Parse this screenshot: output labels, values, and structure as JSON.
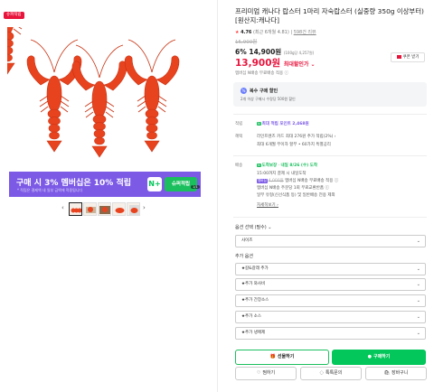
{
  "gallery": {
    "badge": "슈퍼적립",
    "promo_main": "구매 시 3% 멤버십은 10% 적립",
    "promo_sub": "* 적립은 결제액 내 일부 금액에 적용됩니다",
    "promo_n": "N+",
    "promo_super": "슈퍼적립",
    "page_indicator": "1/1",
    "prev": "‹",
    "next": "›",
    "lobster_color": "#e8431f"
  },
  "product": {
    "title": "프리미엄 캐나다 랍스터 1마리 자숙랍스터 (실중량 350g 이상부터) [원산지:캐나다]",
    "star": "★",
    "score": "4.76",
    "rating_note": "(최근 6개월 4.81)",
    "reviews": "598건 리뷰",
    "original_price": "15,900원",
    "discount_line": "6% 14,900원",
    "unit_price": "(100g당 4,257원)",
    "max_price": "13,900원",
    "max_label": "최대할인가 ⌄",
    "coupon_label": "쿠폰 받기",
    "membership_line_strike": "4,000원",
    "membership_line": "멤버십 N배송 무료배송 적용 ⓘ"
  },
  "multi_discount": {
    "icon": "%",
    "title": "복수 구매 할인",
    "desc": "2개 이상 구매시 수량당 500원 할인"
  },
  "benefits": {
    "point_label": "적립",
    "point_tag": "N",
    "point_text": "최대 적립 포인트 2,468원",
    "benefit_label": "혜택",
    "benefit_line1": "라인프렌즈 카드 최대 276원 추가 적립(2%) ›",
    "benefit_line2": "최대 6개월 무이자 할부 • 60가지 특별공리"
  },
  "delivery": {
    "label": "배송",
    "tag": "N",
    "tag_text": "도착보장",
    "arrive": "내일 8/26 (수) 도착",
    "line2": "15:00까지 결제 시 내일도착",
    "mem_tag": "멤버십",
    "line3_strike": "4,000원",
    "line3": "멤버십 N배송 무료배송 적용 ⓘ",
    "line4": "멤버십 N배송 주문당 1회 무료교환반품 ⓘ",
    "line5": "일부 유형(신선식품 등) 및 일반배송 전용 제외",
    "more": "자세히보기 ›"
  },
  "options": {
    "title": "옵션 선택 (필수) ⌄",
    "size_select": "사이즈",
    "extra_title": "추가 옵션",
    "extras": [
      "★갈&갈래 추가",
      "★추가 와사비",
      "★추가 간장소스",
      "★추가 소스",
      "★추가 냉매제"
    ],
    "chevron": "⌄"
  },
  "actions": {
    "cart": "선물하기",
    "buy": "구매하기",
    "like": "찜하기",
    "talk": "톡톡문의",
    "basket": "장바구니"
  }
}
